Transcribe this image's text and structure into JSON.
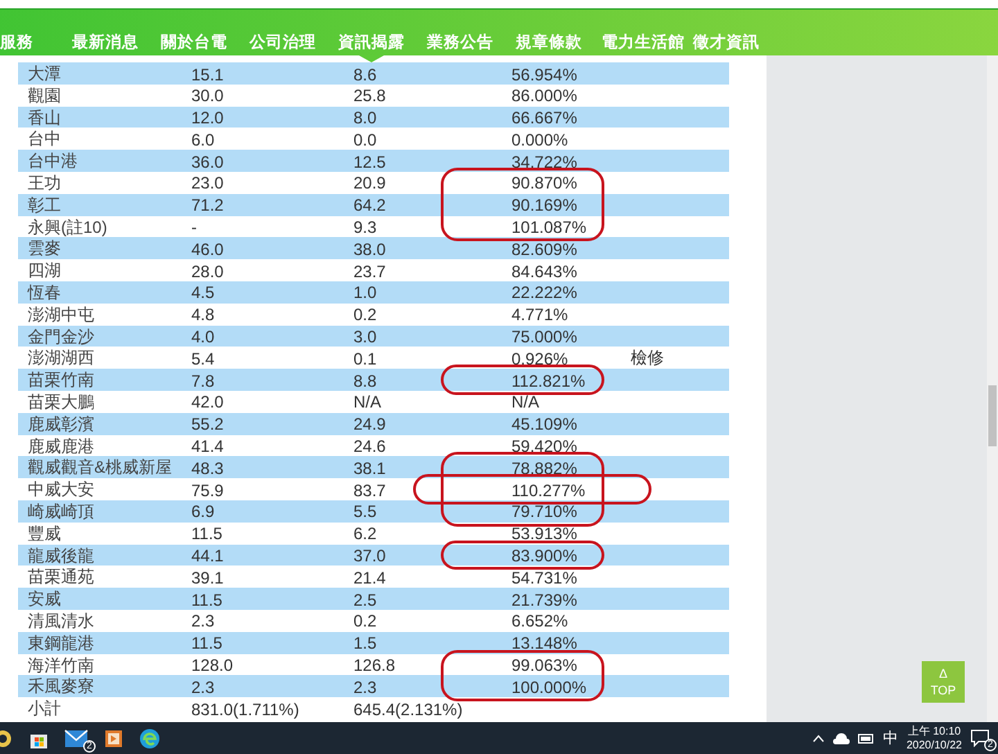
{
  "nav": [
    {
      "label": "服務",
      "selected": false
    },
    {
      "label": "最新消息",
      "selected": false
    },
    {
      "label": "關於台電",
      "selected": false
    },
    {
      "label": "公司治理",
      "selected": false
    },
    {
      "label": "資訊揭露",
      "selected": true
    },
    {
      "label": "業務公告",
      "selected": false
    },
    {
      "label": "規章條款",
      "selected": false
    },
    {
      "label": "電力生活館",
      "selected": false
    },
    {
      "label": "徵才資訊",
      "selected": false
    }
  ],
  "table": {
    "rows": [
      {
        "cells": [
          "大潭",
          "15.1",
          "8.6",
          "56.954%"
        ],
        "circled": false,
        "wide_circle": false
      },
      {
        "cells": [
          "觀園",
          "30.0",
          "25.8",
          "86.000%"
        ],
        "circled": false,
        "wide_circle": false
      },
      {
        "cells": [
          "香山",
          "12.0",
          "8.0",
          "66.667%"
        ],
        "circled": false,
        "wide_circle": false
      },
      {
        "cells": [
          "台中",
          "6.0",
          "0.0",
          "0.000%"
        ],
        "circled": false,
        "wide_circle": false
      },
      {
        "cells": [
          "台中港",
          "36.0",
          "12.5",
          "34.722%"
        ],
        "circled": false,
        "wide_circle": false
      },
      {
        "cells": [
          "王功",
          "23.0",
          "20.9",
          "90.870%"
        ],
        "circled": true,
        "wide_circle": false
      },
      {
        "cells": [
          "彰工",
          "71.2",
          "64.2",
          "90.169%"
        ],
        "circled": true,
        "wide_circle": false
      },
      {
        "cells": [
          "永興(註10)",
          "-",
          "9.3",
          "101.087%"
        ],
        "circled": true,
        "wide_circle": false
      },
      {
        "cells": [
          "雲麥",
          "46.0",
          "38.0",
          "82.609%"
        ],
        "circled": false,
        "wide_circle": false
      },
      {
        "cells": [
          "四湖",
          "28.0",
          "23.7",
          "84.643%"
        ],
        "circled": false,
        "wide_circle": false
      },
      {
        "cells": [
          "恆春",
          "4.5",
          "1.0",
          "22.222%"
        ],
        "circled": false,
        "wide_circle": false
      },
      {
        "cells": [
          "澎湖中屯",
          "4.8",
          "0.2",
          "4.771%"
        ],
        "circled": false,
        "wide_circle": false
      },
      {
        "cells": [
          "金門金沙",
          "4.0",
          "3.0",
          "75.000%"
        ],
        "circled": false,
        "wide_circle": false
      },
      {
        "cells": [
          "澎湖湖西",
          "5.4",
          "0.1",
          "0.926%",
          "檢修"
        ],
        "circled": false,
        "wide_circle": false
      },
      {
        "cells": [
          "苗栗竹南",
          "7.8",
          "8.8",
          "112.821%"
        ],
        "circled": true,
        "wide_circle": false
      },
      {
        "cells": [
          "苗栗大鵬",
          "42.0",
          "N/A",
          "N/A"
        ],
        "circled": false,
        "wide_circle": false
      },
      {
        "cells": [
          "鹿威彰濱",
          "55.2",
          "24.9",
          "45.109%"
        ],
        "circled": false,
        "wide_circle": false
      },
      {
        "cells": [
          "鹿威鹿港",
          "41.4",
          "24.6",
          "59.420%"
        ],
        "circled": false,
        "wide_circle": false
      },
      {
        "cells": [
          "觀威觀音&桃威新屋",
          "48.3",
          "38.1",
          "78.882%"
        ],
        "circled": true,
        "wide_circle": false
      },
      {
        "cells": [
          "中威大安",
          "75.9",
          "83.7",
          "110.277%"
        ],
        "circled": true,
        "wide_circle": true
      },
      {
        "cells": [
          "崎威崎頂",
          "6.9",
          "5.5",
          "79.710%"
        ],
        "circled": true,
        "wide_circle": false
      },
      {
        "cells": [
          "豐威",
          "11.5",
          "6.2",
          "53.913%"
        ],
        "circled": false,
        "wide_circle": false
      },
      {
        "cells": [
          "龍威後龍",
          "44.1",
          "37.0",
          "83.900%"
        ],
        "circled": true,
        "wide_circle": false
      },
      {
        "cells": [
          "苗栗通苑",
          "39.1",
          "21.4",
          "54.731%"
        ],
        "circled": false,
        "wide_circle": false
      },
      {
        "cells": [
          "安威",
          "11.5",
          "2.5",
          "21.739%"
        ],
        "circled": false,
        "wide_circle": false
      },
      {
        "cells": [
          "清風清水",
          "2.3",
          "0.2",
          "6.652%"
        ],
        "circled": false,
        "wide_circle": false
      },
      {
        "cells": [
          "東鋼龍港",
          "11.5",
          "1.5",
          "13.148%"
        ],
        "circled": false,
        "wide_circle": false
      },
      {
        "cells": [
          "海洋竹南",
          "128.0",
          "126.8",
          "99.063%"
        ],
        "circled": true,
        "wide_circle": false
      },
      {
        "cells": [
          "禾風麥寮",
          "2.3",
          "2.3",
          "100.000%"
        ],
        "circled": true,
        "wide_circle": false
      }
    ],
    "subtotal": [
      "小計",
      "831.0(1.711%)",
      "645.4(2.131%)"
    ]
  },
  "top_button": {
    "icon": "Δ",
    "label": "TOP"
  },
  "taskbar": {
    "mail_badge": "2",
    "ime": "中",
    "time": "上午 10:10",
    "date": "2020/10/22",
    "notification_badge": "2"
  }
}
